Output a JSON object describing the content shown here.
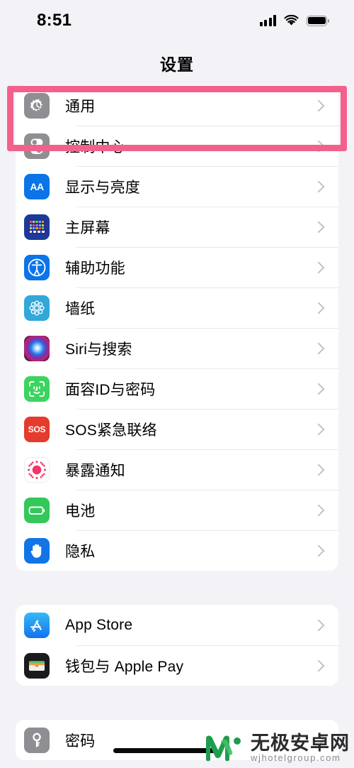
{
  "status_bar": {
    "time": "8:51",
    "signal_icon": "cellular-signal-icon",
    "wifi_icon": "wifi-icon",
    "battery_icon": "battery-full-icon"
  },
  "nav": {
    "title": "设置"
  },
  "highlight": {
    "target": "通用",
    "color": "#F2618C"
  },
  "sections": [
    {
      "id": "system",
      "rows": [
        {
          "label": "通用",
          "icon": "gear-icon",
          "icon_color": "#8E8E93"
        },
        {
          "label": "控制中心",
          "icon": "control-center-icon",
          "icon_color": "#8E8E93"
        },
        {
          "label": "显示与亮度",
          "icon": "display-brightness-icon",
          "icon_color": "#0B74E8"
        },
        {
          "label": "主屏幕",
          "icon": "home-screen-icon",
          "icon_color": "#1B3A9B"
        },
        {
          "label": "辅助功能",
          "icon": "accessibility-icon",
          "icon_color": "#0B74E8"
        },
        {
          "label": "墙纸",
          "icon": "wallpaper-icon",
          "icon_color": "#31A8D8"
        },
        {
          "label": "Siri与搜索",
          "icon": "siri-icon",
          "icon_color": "#16121C"
        },
        {
          "label": "面容ID与密码",
          "icon": "face-id-icon",
          "icon_color": "#3BD45F"
        },
        {
          "label": "SOS紧急联络",
          "icon": "sos-icon",
          "icon_color": "#E43B2E"
        },
        {
          "label": "暴露通知",
          "icon": "exposure-notification-icon",
          "icon_color": "#FFFFFF"
        },
        {
          "label": "电池",
          "icon": "battery-icon",
          "icon_color": "#34C759"
        },
        {
          "label": "隐私",
          "icon": "privacy-hand-icon",
          "icon_color": "#1175E8"
        }
      ]
    },
    {
      "id": "store",
      "rows": [
        {
          "label": "App Store",
          "icon": "app-store-icon",
          "icon_color": "#1473EE"
        },
        {
          "label": "钱包与 Apple Pay",
          "icon": "wallet-icon",
          "icon_color": "#1B1B1D"
        }
      ]
    },
    {
      "id": "accounts",
      "rows": [
        {
          "label": "密码",
          "icon": "key-icon",
          "icon_color": "#8E8E93"
        }
      ]
    }
  ],
  "chevron_icon": "chevron-right-icon",
  "watermark": {
    "logo": "w-logo-icon",
    "name_cn": "无极安卓网",
    "name_en": "wjhotelgroup.com"
  }
}
